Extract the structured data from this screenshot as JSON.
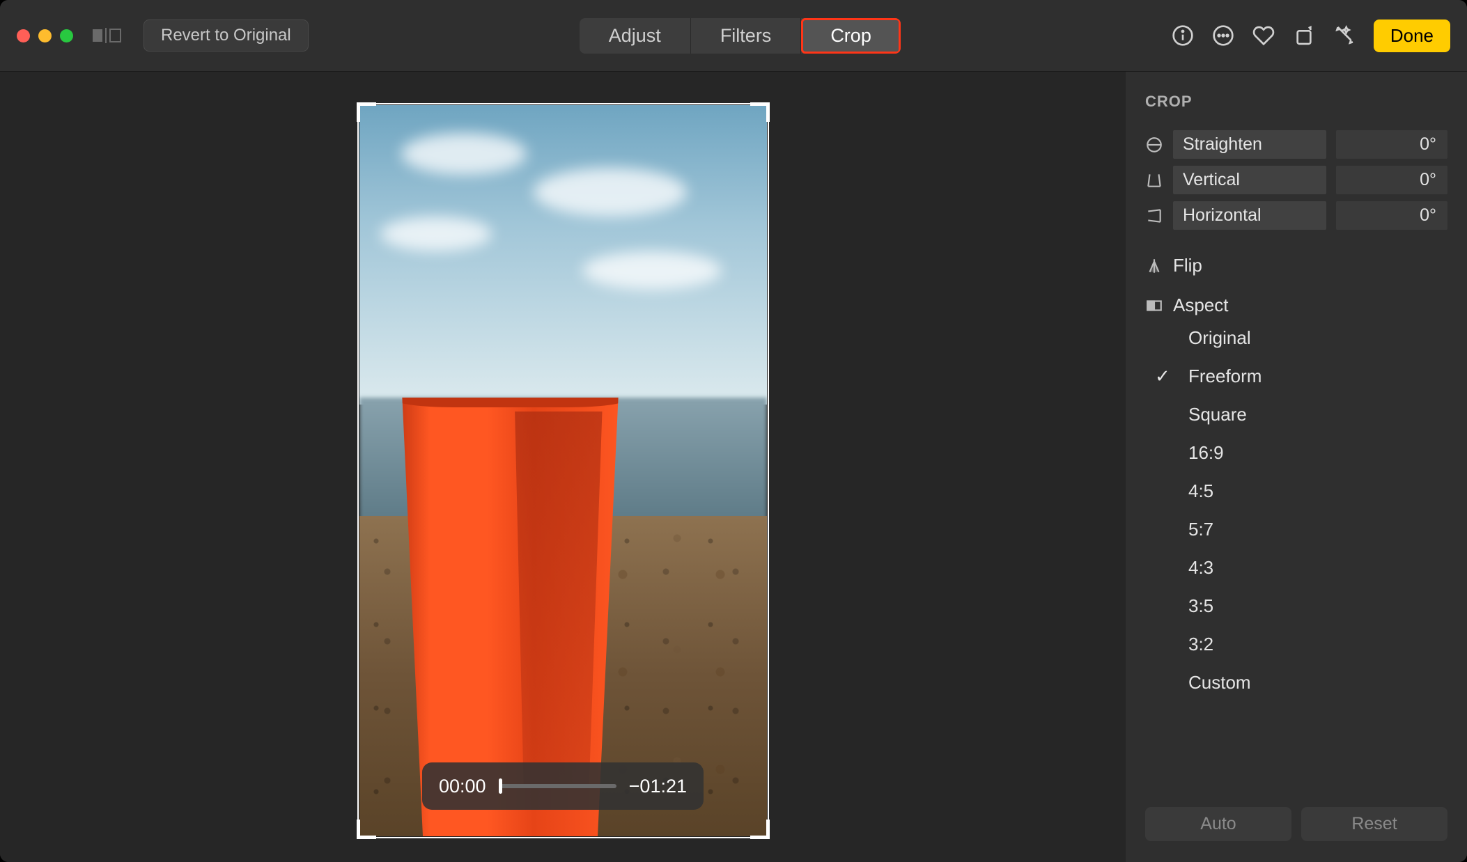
{
  "toolbar": {
    "revert_label": "Revert to Original",
    "tabs": {
      "adjust": "Adjust",
      "filters": "Filters",
      "crop": "Crop"
    },
    "done_label": "Done"
  },
  "video": {
    "current_time": "00:00",
    "remaining_time": "−01:21"
  },
  "sidebar": {
    "title": "CROP",
    "straighten": {
      "label": "Straighten",
      "value": "0°"
    },
    "vertical": {
      "label": "Vertical",
      "value": "0°"
    },
    "horizontal": {
      "label": "Horizontal",
      "value": "0°"
    },
    "flip_label": "Flip",
    "aspect_label": "Aspect",
    "aspect_options": {
      "original": "Original",
      "freeform": "Freeform",
      "square": "Square",
      "r16_9": "16:9",
      "r4_5": "4:5",
      "r5_7": "5:7",
      "r4_3": "4:3",
      "r3_5": "3:5",
      "r3_2": "3:2",
      "custom": "Custom"
    },
    "aspect_selected": "freeform",
    "auto_label": "Auto",
    "reset_label": "Reset"
  }
}
